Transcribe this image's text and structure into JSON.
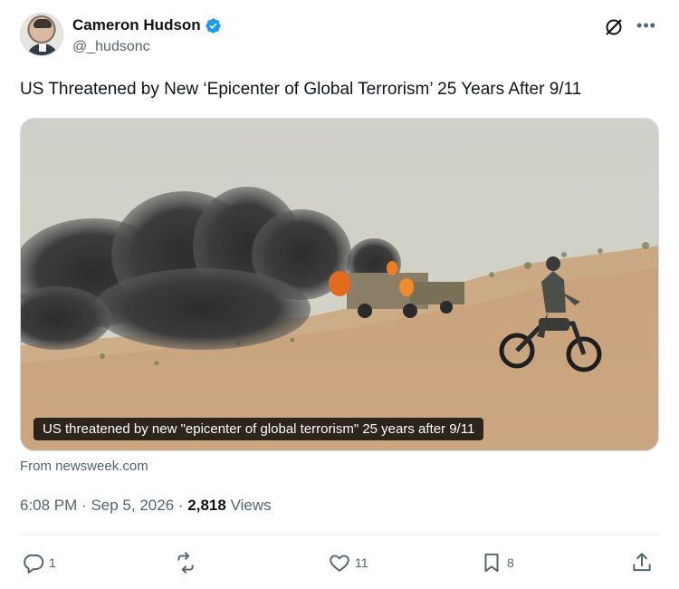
{
  "author": {
    "display_name": "Cameron Hudson",
    "handle": "@_hudsonc"
  },
  "tweet": {
    "text": "US Threatened by New ‘Epicenter of Global Terrorism’ 25 Years After 9/11"
  },
  "media": {
    "caption": "US threatened by new \"epicenter of global terrorism\" 25 years after 9/11",
    "source": "From newsweek.com"
  },
  "meta": {
    "time": "6:08 PM",
    "sep1": "·",
    "date": "Sep 5, 2026",
    "sep2": "·",
    "views_count": "2,818",
    "views_label": "Views"
  },
  "actions": {
    "replies": "1",
    "retweets": "",
    "likes": "11",
    "bookmarks": "8"
  },
  "icons": {
    "verified": "verified-badge-icon",
    "grok": "grok-icon",
    "more": "more-icon",
    "reply": "reply-icon",
    "retweet": "retweet-icon",
    "like": "heart-icon",
    "bookmark": "bookmark-icon",
    "share": "share-icon"
  },
  "colors": {
    "verified_blue": "#1d9bf0",
    "secondary_text": "#536471",
    "primary_text": "#0f1419"
  }
}
